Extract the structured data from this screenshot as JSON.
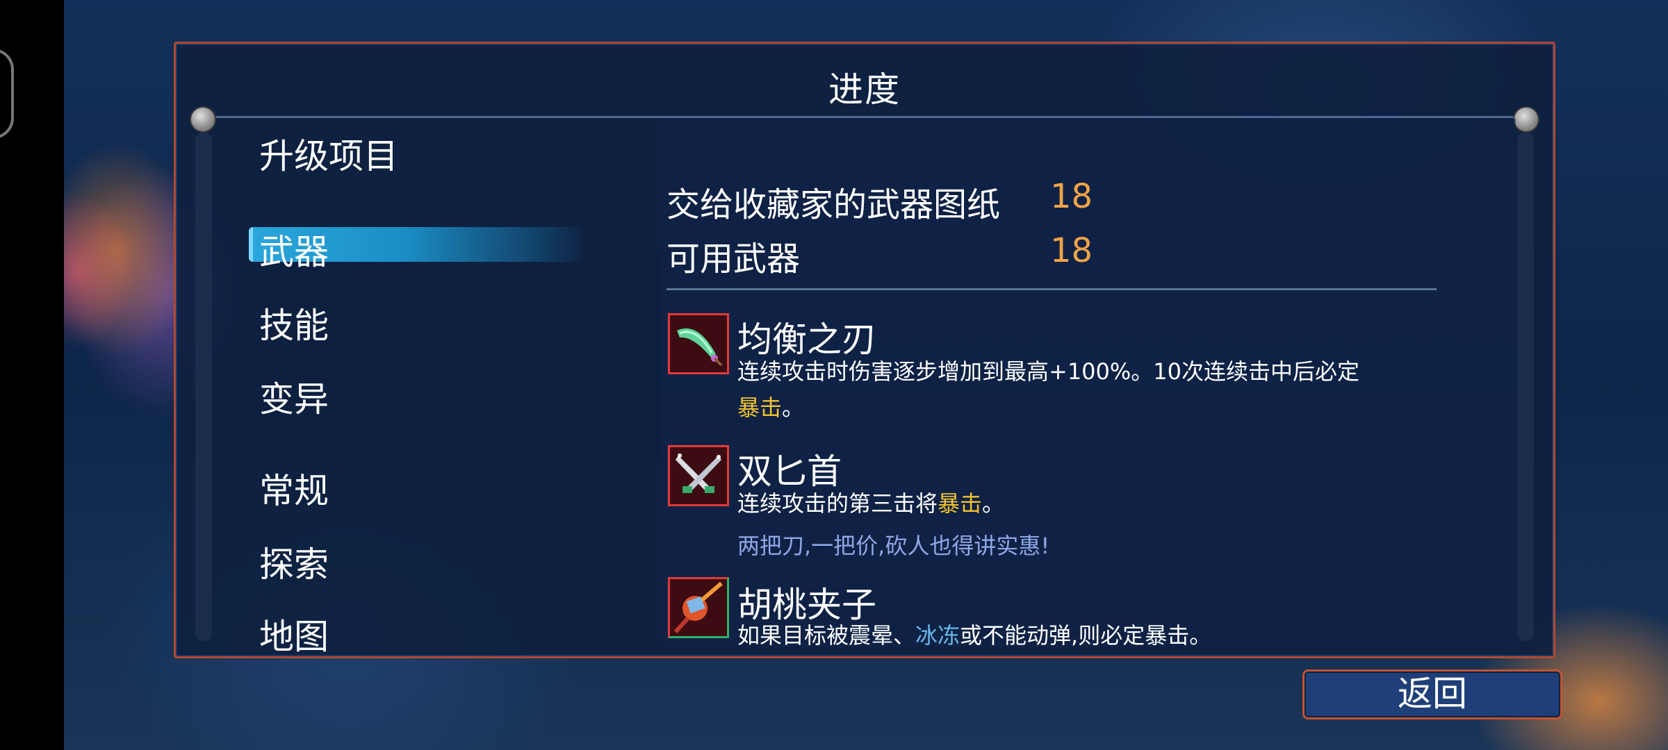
{
  "panel": {
    "title": "进度"
  },
  "sidebar": {
    "items": [
      {
        "label": "升级项目"
      },
      {
        "label": "武器",
        "selected": true
      },
      {
        "label": "技能"
      },
      {
        "label": "变异"
      },
      {
        "label": "常规"
      },
      {
        "label": "探索"
      },
      {
        "label": "地图"
      }
    ]
  },
  "stats": [
    {
      "label": "交给收藏家的武器图纸",
      "value": "18"
    },
    {
      "label": "可用武器",
      "value": "18"
    }
  ],
  "weapons": [
    {
      "name": "均衡之刃",
      "desc_a": "连续攻击时伤害逐步增加到最高+100%。10次连续击中后必定",
      "desc_hl": "暴击",
      "desc_end": "。",
      "icon": "green-blade-icon"
    },
    {
      "name": "双匕首",
      "desc_a": "连续攻击的第三击将",
      "desc_hl": "暴击",
      "desc_end": "。",
      "flavor": "两把刀,一把价,砍人也得讲实惠!",
      "icon": "twin-daggers-icon"
    },
    {
      "name": "胡桃夹子",
      "desc_a": "如果目标被震晕、",
      "desc_hl": "冰冻",
      "desc_end": "或不能动弹,则必定暴击。",
      "icon": "nutcracker-icon"
    }
  ],
  "colors": {
    "frame": "#b3492e",
    "value": "#f0a446",
    "crit": "#f2c230",
    "freeze": "#69b7e8",
    "flavor": "#8fa7e6",
    "highlight": "#2aa6dc"
  },
  "footer": {
    "back_label": "返回"
  }
}
